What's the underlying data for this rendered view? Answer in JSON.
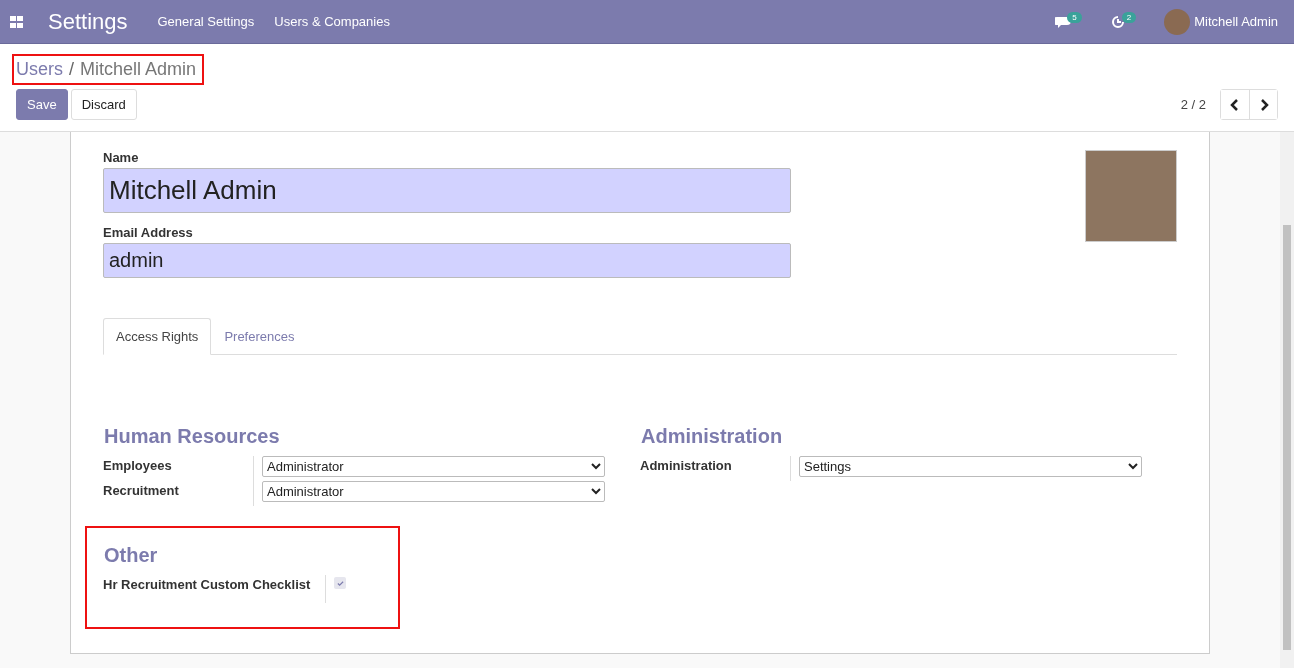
{
  "navbar": {
    "app_title": "Settings",
    "menu": [
      "General Settings",
      "Users & Companies"
    ],
    "messages_count": "5",
    "activities_count": "2",
    "user_name": "Mitchell Admin"
  },
  "breadcrumb": {
    "items": [
      "Users",
      "Mitchell Admin"
    ],
    "separator": "/",
    "highlighted": true
  },
  "actions": {
    "buttons": [
      {
        "label": "Save",
        "kind": "primary"
      },
      {
        "label": "Discard",
        "kind": "secondary"
      }
    ],
    "pager": "2 / 2"
  },
  "form": {
    "name_label": "Name",
    "name_value": "Mitchell Admin",
    "email_label": "Email Address",
    "email_value": "admin",
    "tabs": [
      {
        "label": "Access Rights",
        "selected": true
      },
      {
        "label": "Preferences",
        "selected": false
      }
    ],
    "groups": [
      {
        "title": "Human Resources",
        "highlighted": false,
        "fields": [
          {
            "kind": "select",
            "label": "Employees",
            "value": "Administrator"
          },
          {
            "kind": "select",
            "label": "Recruitment",
            "value": "Administrator"
          }
        ]
      },
      {
        "title": "Administration",
        "highlighted": false,
        "fields": [
          {
            "kind": "select",
            "label": "Administration",
            "value": "Settings"
          }
        ]
      },
      {
        "title": "Other",
        "highlighted": true,
        "fields": [
          {
            "kind": "checkbox",
            "label": "Hr Recruitment Custom Checklist",
            "checked": true
          }
        ]
      }
    ]
  }
}
